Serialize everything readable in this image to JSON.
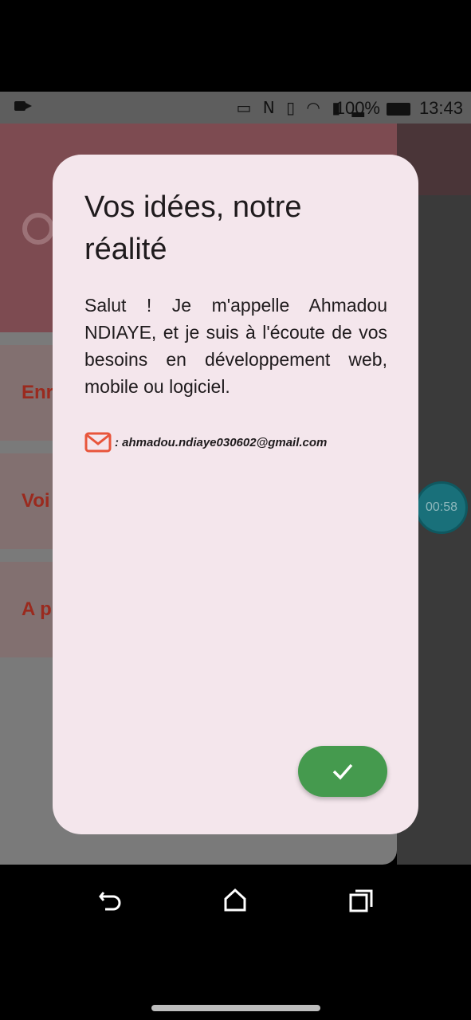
{
  "status_bar": {
    "icons": [
      "camera-icon",
      "laptop-icon",
      "nfc-icon",
      "vibrate-icon",
      "wifi-icon",
      "sim-icon",
      "signal-icon",
      "battery-icon"
    ],
    "battery_percent": "100%",
    "time": "13:43"
  },
  "background_app": {
    "items": [
      {
        "label": "Enr"
      },
      {
        "label": "Voi"
      },
      {
        "label": "A p"
      }
    ]
  },
  "timer": {
    "label": "00:58"
  },
  "dialog": {
    "title": "Vos idées, notre réalité",
    "body": "Salut ! Je m'appelle Ahmadou NDIAYE, et je suis à l'écoute de vos besoins en développement web, mobile ou logiciel.",
    "contact_email": ": ahmadou.ndiaye030602@gmail.com",
    "confirm_icon": "check-icon"
  },
  "colors": {
    "dialog_bg": "#f4e6ec",
    "confirm_button": "#459a4e",
    "mail_icon": "#e8553b",
    "header_accent": "#7d4b51"
  },
  "nav_bar": {
    "buttons": [
      "back-icon",
      "home-icon",
      "recents-icon"
    ]
  }
}
